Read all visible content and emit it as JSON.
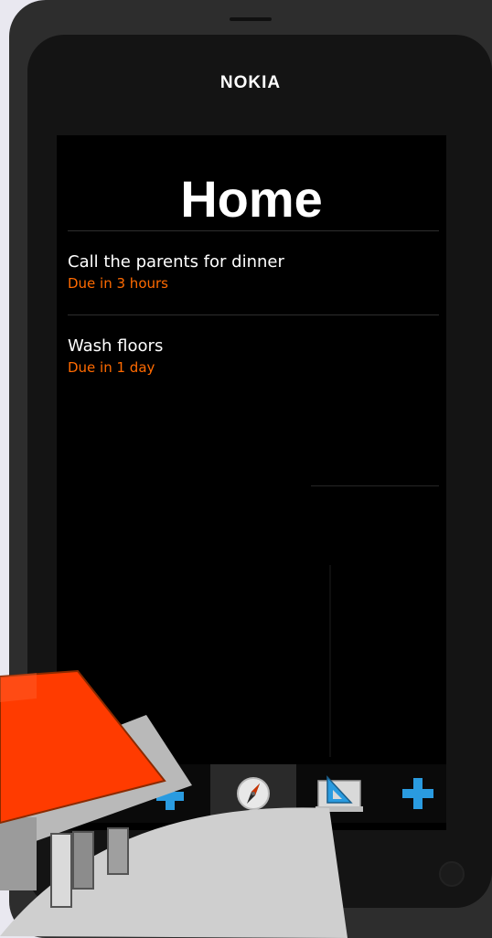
{
  "device": {
    "brand": "NOKIA"
  },
  "page": {
    "title": "Home"
  },
  "tasks": [
    {
      "title": "Call the parents for dinner",
      "due": "Due in 3 hours"
    },
    {
      "title": "Wash floors",
      "due": "Due in 1 day"
    }
  ],
  "toolbar": {
    "buttons": [
      {
        "icon": "home-add-icon"
      },
      {
        "icon": "compass-icon",
        "active": true
      },
      {
        "icon": "set-square-icon"
      },
      {
        "icon": "plus-icon"
      }
    ]
  },
  "colors": {
    "accent": "#ff6a00",
    "screen_background": "#000000",
    "text": "#ffffff",
    "toolbar_active": "#2a2a2a",
    "plus_blue": "#2a9be0",
    "roof_red": "#ff3b00"
  }
}
